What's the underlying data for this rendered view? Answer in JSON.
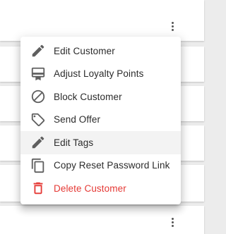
{
  "menu": {
    "items": [
      {
        "label": "Edit Customer",
        "icon": "pencil-icon"
      },
      {
        "label": "Adjust Loyalty Points",
        "icon": "loyalty-card-icon"
      },
      {
        "label": "Block Customer",
        "icon": "block-icon"
      },
      {
        "label": "Send Offer",
        "icon": "tag-icon"
      },
      {
        "label": "Edit Tags",
        "icon": "pencil-icon"
      },
      {
        "label": "Copy Reset Password Link",
        "icon": "copy-icon"
      },
      {
        "label": "Delete Customer",
        "icon": "trash-icon"
      }
    ],
    "hovered_item": "Edit Tags"
  },
  "colors": {
    "icon": "#5f5f5f",
    "text": "#2b2b2b",
    "danger": "#e53935",
    "hover_bg": "#f3f3f3",
    "page_bg": "#ececec"
  }
}
